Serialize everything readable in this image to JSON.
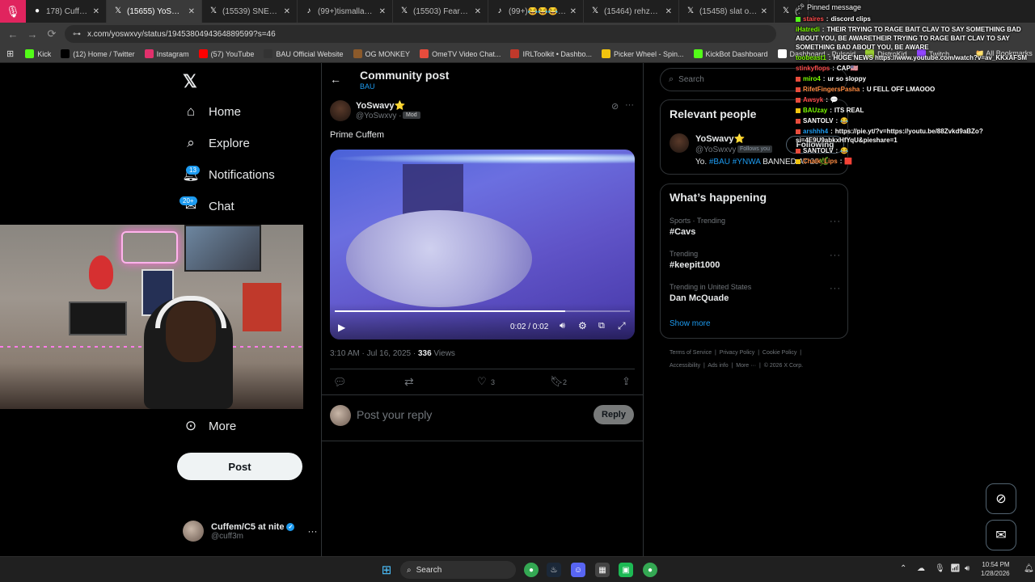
{
  "browser": {
    "tabs": [
      {
        "title": "178) Cuffem & iSh",
        "active": false,
        "icon": "recording-icon"
      },
      {
        "title": "(15655) YoSwavy⭐",
        "active": true,
        "icon": "x-logo-icon"
      },
      {
        "title": "(15539) SNEAKO D/",
        "active": false,
        "icon": "x-logo-icon"
      },
      {
        "title": "(99+)tismalla_hood",
        "active": false,
        "icon": "tiktok-icon"
      },
      {
        "title": "(15503) FearBuck o",
        "active": false,
        "icon": "x-logo-icon"
      },
      {
        "title": "(99+)😂😂😂😂",
        "active": false,
        "icon": "tiktok-icon"
      },
      {
        "title": "(15464) rehzzi on X",
        "active": false,
        "icon": "x-logo-icon"
      },
      {
        "title": "(15458) slat on X: \"",
        "active": false,
        "icon": "x-logo-icon"
      },
      {
        "title": "(1565",
        "active": false,
        "icon": "x-logo-icon"
      }
    ],
    "url": "x.com/yoswxvy/status/1945380494364889599?s=46",
    "bookmarks": [
      {
        "label": "Kick",
        "color": "#53fc18"
      },
      {
        "label": "(12) Home / Twitter",
        "color": "#000000"
      },
      {
        "label": "Instagram",
        "color": "#e1306c"
      },
      {
        "label": "(57) YouTube",
        "color": "#ff0000"
      },
      {
        "label": "BAU Official Website",
        "color": "#333333"
      },
      {
        "label": "OG MONKEY",
        "color": "#8b5a2b"
      },
      {
        "label": "OmeTV Video Chat...",
        "color": "#e74c3c"
      },
      {
        "label": "IRLToolkit • Dashbo...",
        "color": "#c0392b"
      },
      {
        "label": "Picker Wheel - Spin...",
        "color": "#f1c40f"
      },
      {
        "label": "KickBot Dashboard",
        "color": "#53fc18"
      },
      {
        "label": "Dashboard - Pulsoid",
        "color": "#ffffff"
      },
      {
        "label": "DistroKid",
        "color": "#9acd32"
      },
      {
        "label": "Twitch",
        "color": "#9146ff"
      }
    ],
    "all_bookmarks": "All Bookmarks"
  },
  "nav": {
    "items": [
      {
        "label": "Home",
        "icon": "home-icon"
      },
      {
        "label": "Explore",
        "icon": "search-icon"
      },
      {
        "label": "Notifications",
        "icon": "bell-icon",
        "badge": "13"
      },
      {
        "label": "Chat",
        "icon": "mail-icon",
        "badge": "20+"
      }
    ],
    "more": "More",
    "post": "Post",
    "account_name": "Cuffem/C5 at nite",
    "account_handle": "@cuff3m"
  },
  "post": {
    "header_title": "Community post",
    "header_sub": "BAU",
    "author_name": "YoSwavy⭐",
    "author_handle": "@YoSwxvy ·",
    "mod_badge": "Mod",
    "text": "Prime Cuffem",
    "video_time": "0:02 / 0:02",
    "video_progress": 0.78,
    "meta_time": "3:10 AM · Jul 16, 2025 ·",
    "views_count": "336",
    "views_label": "Views",
    "likes": "3",
    "bookmarks": "2",
    "reply_placeholder": "Post your reply",
    "reply_button": "Reply"
  },
  "right": {
    "search_placeholder": "Search",
    "relevant_title": "Relevant people",
    "person_name": "YoSwavy⭐",
    "person_handle": "@YoSwxvy",
    "follows_you": "Follows you",
    "following_button": "Following",
    "bio_prefix": "Yo.",
    "bio_tag1": "#BAU",
    "bio_tag2": "#YNWA",
    "bio_suffix": "BANNED AT 20🌿",
    "happening_title": "What’s happening",
    "trends": [
      {
        "meta": "Sports · Trending",
        "title": "#Cavs"
      },
      {
        "meta": "Trending",
        "title": "#keepit1000"
      },
      {
        "meta": "Trending in United States",
        "title": "Dan McQuade"
      }
    ],
    "show_more": "Show more",
    "footer_row1": [
      "Terms of Service",
      "Privacy Policy",
      "Cookie Policy"
    ],
    "footer_row2": [
      "Accessibility",
      "Ads info",
      "More ···",
      "© 2026 X Corp."
    ]
  },
  "chat": {
    "pinned_label": "Pinned message",
    "messages": [
      {
        "user": "staires",
        "color": "#ff4d4d",
        "text": "discord clips",
        "badge": "#53fc18"
      },
      {
        "user": "iHatredi",
        "color": "#7cfc00",
        "text": "THEIR TRYING TO RAGE BAIT CLAV TO SAY SOMETHING BAD ABOUT YOU, BE AWARETHEIR TRYING TO RAGE BAIT CLAV TO SAY SOMETHING BAD ABOUT YOU, BE AWARE",
        "badge": ""
      },
      {
        "user": "toobeast1",
        "color": "#7cfc00",
        "text": "HUGE NEWS https://www.youtube.com/watch?v=av_KKxAFSM",
        "badge": ""
      },
      {
        "user": "stinkyflops",
        "color": "#ff4d4d",
        "text": "CAP🇺🇸",
        "badge": ""
      },
      {
        "user": "miro4",
        "color": "#7cfc00",
        "text": "ur so sloppy",
        "badge": "#e74c3c"
      },
      {
        "user": "RifetFingersPasha",
        "color": "#ff8c42",
        "text": "U FELL OFF LMAOOO",
        "badge": "#e74c3c"
      },
      {
        "user": "Awsyk",
        "color": "#ff4d4d",
        "text": "💬",
        "badge": "#e74c3c"
      },
      {
        "user": "BAUzay",
        "color": "#7cfc00",
        "text": "ITS REAL",
        "badge": "#f1c40f"
      },
      {
        "user": "SANTOLV",
        "color": "#ffffff",
        "text": "😂",
        "badge": "#e74c3c"
      },
      {
        "user": "arshhh4",
        "color": "#1d9bf0",
        "text": "https://pie.yt/?v=https://youtu.be/88Zvkd9aBZo?si=4E9U9abkxHfYqU&pieshare=1",
        "badge": "#e74c3c"
      },
      {
        "user": "SANTOLV",
        "color": "#ffffff",
        "text": "😂",
        "badge": "#e74c3c"
      },
      {
        "user": "Chalk_Lips",
        "color": "#ff8c42",
        "text": "🟥",
        "badge": "#f1c40f"
      }
    ]
  },
  "taskbar": {
    "search": "Search",
    "time": "10:54 PM",
    "date": "1/28/2026"
  },
  "colors": {
    "accent": "#1d9bf0",
    "background": "#000000",
    "border": "#2f3336",
    "muted": "#71767b"
  }
}
